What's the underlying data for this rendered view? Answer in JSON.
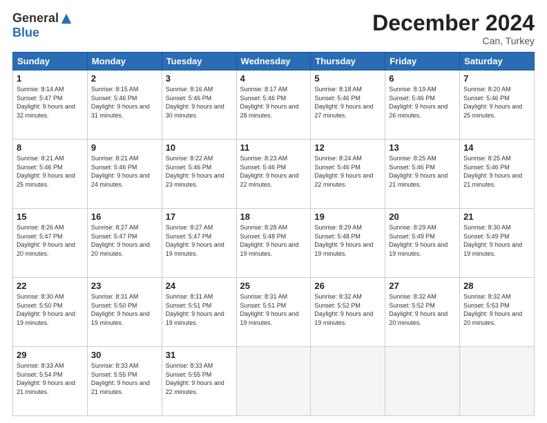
{
  "header": {
    "logo_general": "General",
    "logo_blue": "Blue",
    "month_title": "December 2024",
    "location": "Can, Turkey"
  },
  "weekdays": [
    "Sunday",
    "Monday",
    "Tuesday",
    "Wednesday",
    "Thursday",
    "Friday",
    "Saturday"
  ],
  "weeks": [
    [
      {
        "day": 1,
        "sunrise": "8:14 AM",
        "sunset": "5:47 PM",
        "daylight": "9 hours and 32 minutes."
      },
      {
        "day": 2,
        "sunrise": "8:15 AM",
        "sunset": "5:46 PM",
        "daylight": "9 hours and 31 minutes."
      },
      {
        "day": 3,
        "sunrise": "8:16 AM",
        "sunset": "5:46 PM",
        "daylight": "9 hours and 30 minutes."
      },
      {
        "day": 4,
        "sunrise": "8:17 AM",
        "sunset": "5:46 PM",
        "daylight": "9 hours and 28 minutes."
      },
      {
        "day": 5,
        "sunrise": "8:18 AM",
        "sunset": "5:46 PM",
        "daylight": "9 hours and 27 minutes."
      },
      {
        "day": 6,
        "sunrise": "8:19 AM",
        "sunset": "5:46 PM",
        "daylight": "9 hours and 26 minutes."
      },
      {
        "day": 7,
        "sunrise": "8:20 AM",
        "sunset": "5:46 PM",
        "daylight": "9 hours and 25 minutes."
      }
    ],
    [
      {
        "day": 8,
        "sunrise": "8:21 AM",
        "sunset": "5:46 PM",
        "daylight": "9 hours and 25 minutes."
      },
      {
        "day": 9,
        "sunrise": "8:21 AM",
        "sunset": "5:46 PM",
        "daylight": "9 hours and 24 minutes."
      },
      {
        "day": 10,
        "sunrise": "8:22 AM",
        "sunset": "5:46 PM",
        "daylight": "9 hours and 23 minutes."
      },
      {
        "day": 11,
        "sunrise": "8:23 AM",
        "sunset": "5:46 PM",
        "daylight": "9 hours and 22 minutes."
      },
      {
        "day": 12,
        "sunrise": "8:24 AM",
        "sunset": "5:46 PM",
        "daylight": "9 hours and 22 minutes."
      },
      {
        "day": 13,
        "sunrise": "8:25 AM",
        "sunset": "5:46 PM",
        "daylight": "9 hours and 21 minutes."
      },
      {
        "day": 14,
        "sunrise": "8:25 AM",
        "sunset": "5:46 PM",
        "daylight": "9 hours and 21 minutes."
      }
    ],
    [
      {
        "day": 15,
        "sunrise": "8:26 AM",
        "sunset": "5:47 PM",
        "daylight": "9 hours and 20 minutes."
      },
      {
        "day": 16,
        "sunrise": "8:27 AM",
        "sunset": "5:47 PM",
        "daylight": "9 hours and 20 minutes."
      },
      {
        "day": 17,
        "sunrise": "8:27 AM",
        "sunset": "5:47 PM",
        "daylight": "9 hours and 19 minutes."
      },
      {
        "day": 18,
        "sunrise": "8:28 AM",
        "sunset": "5:48 PM",
        "daylight": "9 hours and 19 minutes."
      },
      {
        "day": 19,
        "sunrise": "8:29 AM",
        "sunset": "5:48 PM",
        "daylight": "9 hours and 19 minutes."
      },
      {
        "day": 20,
        "sunrise": "8:29 AM",
        "sunset": "5:49 PM",
        "daylight": "9 hours and 19 minutes."
      },
      {
        "day": 21,
        "sunrise": "8:30 AM",
        "sunset": "5:49 PM",
        "daylight": "9 hours and 19 minutes."
      }
    ],
    [
      {
        "day": 22,
        "sunrise": "8:30 AM",
        "sunset": "5:50 PM",
        "daylight": "9 hours and 19 minutes."
      },
      {
        "day": 23,
        "sunrise": "8:31 AM",
        "sunset": "5:50 PM",
        "daylight": "9 hours and 19 minutes."
      },
      {
        "day": 24,
        "sunrise": "8:31 AM",
        "sunset": "5:51 PM",
        "daylight": "9 hours and 19 minutes."
      },
      {
        "day": 25,
        "sunrise": "8:31 AM",
        "sunset": "5:51 PM",
        "daylight": "9 hours and 19 minutes."
      },
      {
        "day": 26,
        "sunrise": "8:32 AM",
        "sunset": "5:52 PM",
        "daylight": "9 hours and 19 minutes."
      },
      {
        "day": 27,
        "sunrise": "8:32 AM",
        "sunset": "5:52 PM",
        "daylight": "9 hours and 20 minutes."
      },
      {
        "day": 28,
        "sunrise": "8:32 AM",
        "sunset": "5:53 PM",
        "daylight": "9 hours and 20 minutes."
      }
    ],
    [
      {
        "day": 29,
        "sunrise": "8:33 AM",
        "sunset": "5:54 PM",
        "daylight": "9 hours and 21 minutes."
      },
      {
        "day": 30,
        "sunrise": "8:33 AM",
        "sunset": "5:55 PM",
        "daylight": "9 hours and 21 minutes."
      },
      {
        "day": 31,
        "sunrise": "8:33 AM",
        "sunset": "5:55 PM",
        "daylight": "9 hours and 22 minutes."
      },
      null,
      null,
      null,
      null
    ]
  ]
}
